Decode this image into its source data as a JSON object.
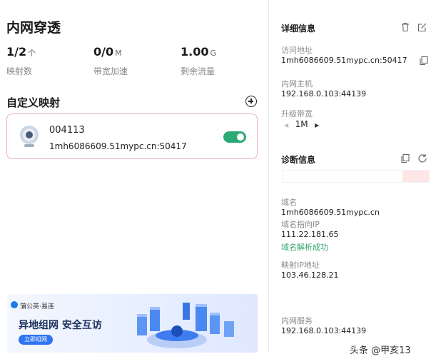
{
  "header": {
    "title": "内网穿透"
  },
  "stats": [
    {
      "value": "1/2",
      "unit": "个",
      "label": "映射数"
    },
    {
      "value": "0/0",
      "unit": "M",
      "label": "带宽加速"
    },
    {
      "value": "1.00",
      "unit": "G",
      "label": "剩余流量"
    }
  ],
  "mappings": {
    "title": "自定义映射",
    "add_icon": "plus-circle-icon",
    "items": [
      {
        "name": "004113",
        "address": "1mh6086609.51mypc.cn:50417",
        "enabled": true,
        "toggle_color": "#2daa74"
      }
    ]
  },
  "banner": {
    "brand": "蒲公英·易连",
    "headline": "异地组网  安全互访",
    "cta": "立即组网"
  },
  "details": {
    "title": "详细信息",
    "access_label": "访问地址",
    "access_value": "1mh6086609.51mypc.cn:50417",
    "host_label": "内网主机",
    "host_value": "192.168.0.103:44139",
    "bandwidth_label": "升级带宽",
    "bandwidth_value": "1M"
  },
  "diagnosis": {
    "title": "诊断信息",
    "progress_fraction": 0.18,
    "domain_label": "域名",
    "domain_value": "1mh6086609.51mypc.cn",
    "ip_label": "域名指向IP",
    "ip_value": "111.22.181.65",
    "resolve_status": "域名解析成功",
    "map_ip_label": "映射IP地址",
    "map_ip_value": "103.46.128.21",
    "service_label": "内网服务",
    "service_value": "192.168.0.103:44139"
  },
  "watermark": "头条 @甲亥13",
  "colors": {
    "accent_green": "#2daa74",
    "card_border": "#e9a9c4",
    "success_text": "#34a56e"
  }
}
